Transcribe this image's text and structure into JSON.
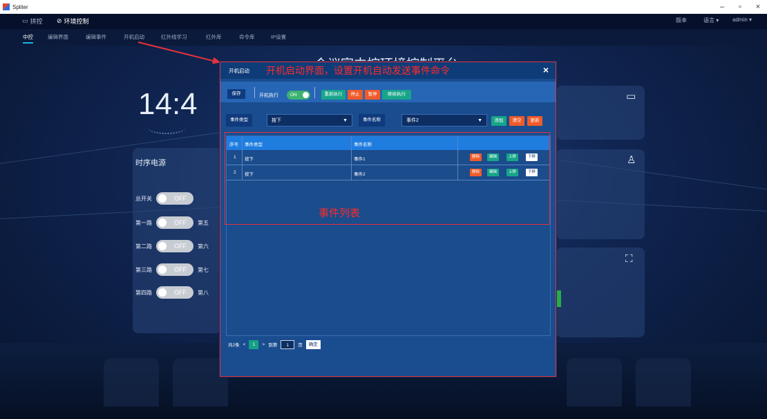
{
  "window": {
    "title": "Spliter",
    "controls": [
      "–",
      "▫",
      "×"
    ]
  },
  "topbar": {
    "tabs": [
      {
        "label": "拼控",
        "icon": "monitor-icon"
      },
      {
        "label": "环境控制",
        "icon": "gauge-icon"
      }
    ],
    "version_label": "版本",
    "language_label": "语言 ▾",
    "user_label": "admin ▾"
  },
  "subnav": {
    "items": [
      "中控",
      "编辑界面",
      "编辑事件",
      "开机启动",
      "红外线学习",
      "红外库",
      "命令库",
      "IP设置"
    ],
    "active_index": 0
  },
  "background": {
    "title": "会议室中控环境控制平台",
    "clock": "14:4",
    "power_panel": {
      "title": "时序电源",
      "master_label": "总开关",
      "rows": [
        {
          "label": "第一路",
          "right": "第五"
        },
        {
          "label": "第二路",
          "right": "第六"
        },
        {
          "label": "第三路",
          "right": "第七"
        },
        {
          "label": "第四路",
          "right": "第八"
        }
      ],
      "off_text": "OFF"
    }
  },
  "dialog": {
    "title": "开机启动",
    "annotation": "开机启动界面，设置开机自动发送事件命令",
    "close": "×",
    "toolbar": {
      "save": "保存",
      "boot_exec_label": "开机执行",
      "switch_on": "ON",
      "reexec": "重新执行",
      "stop": "停止",
      "pause": "暂停",
      "resume": "继续执行"
    },
    "filter": {
      "event_type_label": "事件类型",
      "event_type_value": "按下",
      "event_name_label": "事件名称",
      "event_name_value": "事件2",
      "add": "添加",
      "clear": "清空",
      "update": "更新"
    },
    "table": {
      "headers": [
        "序号",
        "事件类型",
        "事件名称"
      ],
      "rows": [
        {
          "no": "1",
          "type": "按下",
          "name": "事件1"
        },
        {
          "no": "2",
          "type": "按下",
          "name": "事件2"
        }
      ],
      "row_actions": {
        "delete": "删除",
        "edit": "编辑",
        "up": "上移",
        "down": "下移"
      }
    },
    "list_annotation": "事件列表",
    "pager": {
      "total": "共2条",
      "prev": "<",
      "page": "1",
      "next": ">",
      "goto_label": "到第",
      "goto_value": "1",
      "page_unit": "页",
      "confirm": "确定"
    }
  },
  "colors": {
    "accent_red": "#e8323c",
    "teal": "#17a589",
    "orange": "#ef5b2a",
    "dialog_bg": "#1a4d8f"
  }
}
